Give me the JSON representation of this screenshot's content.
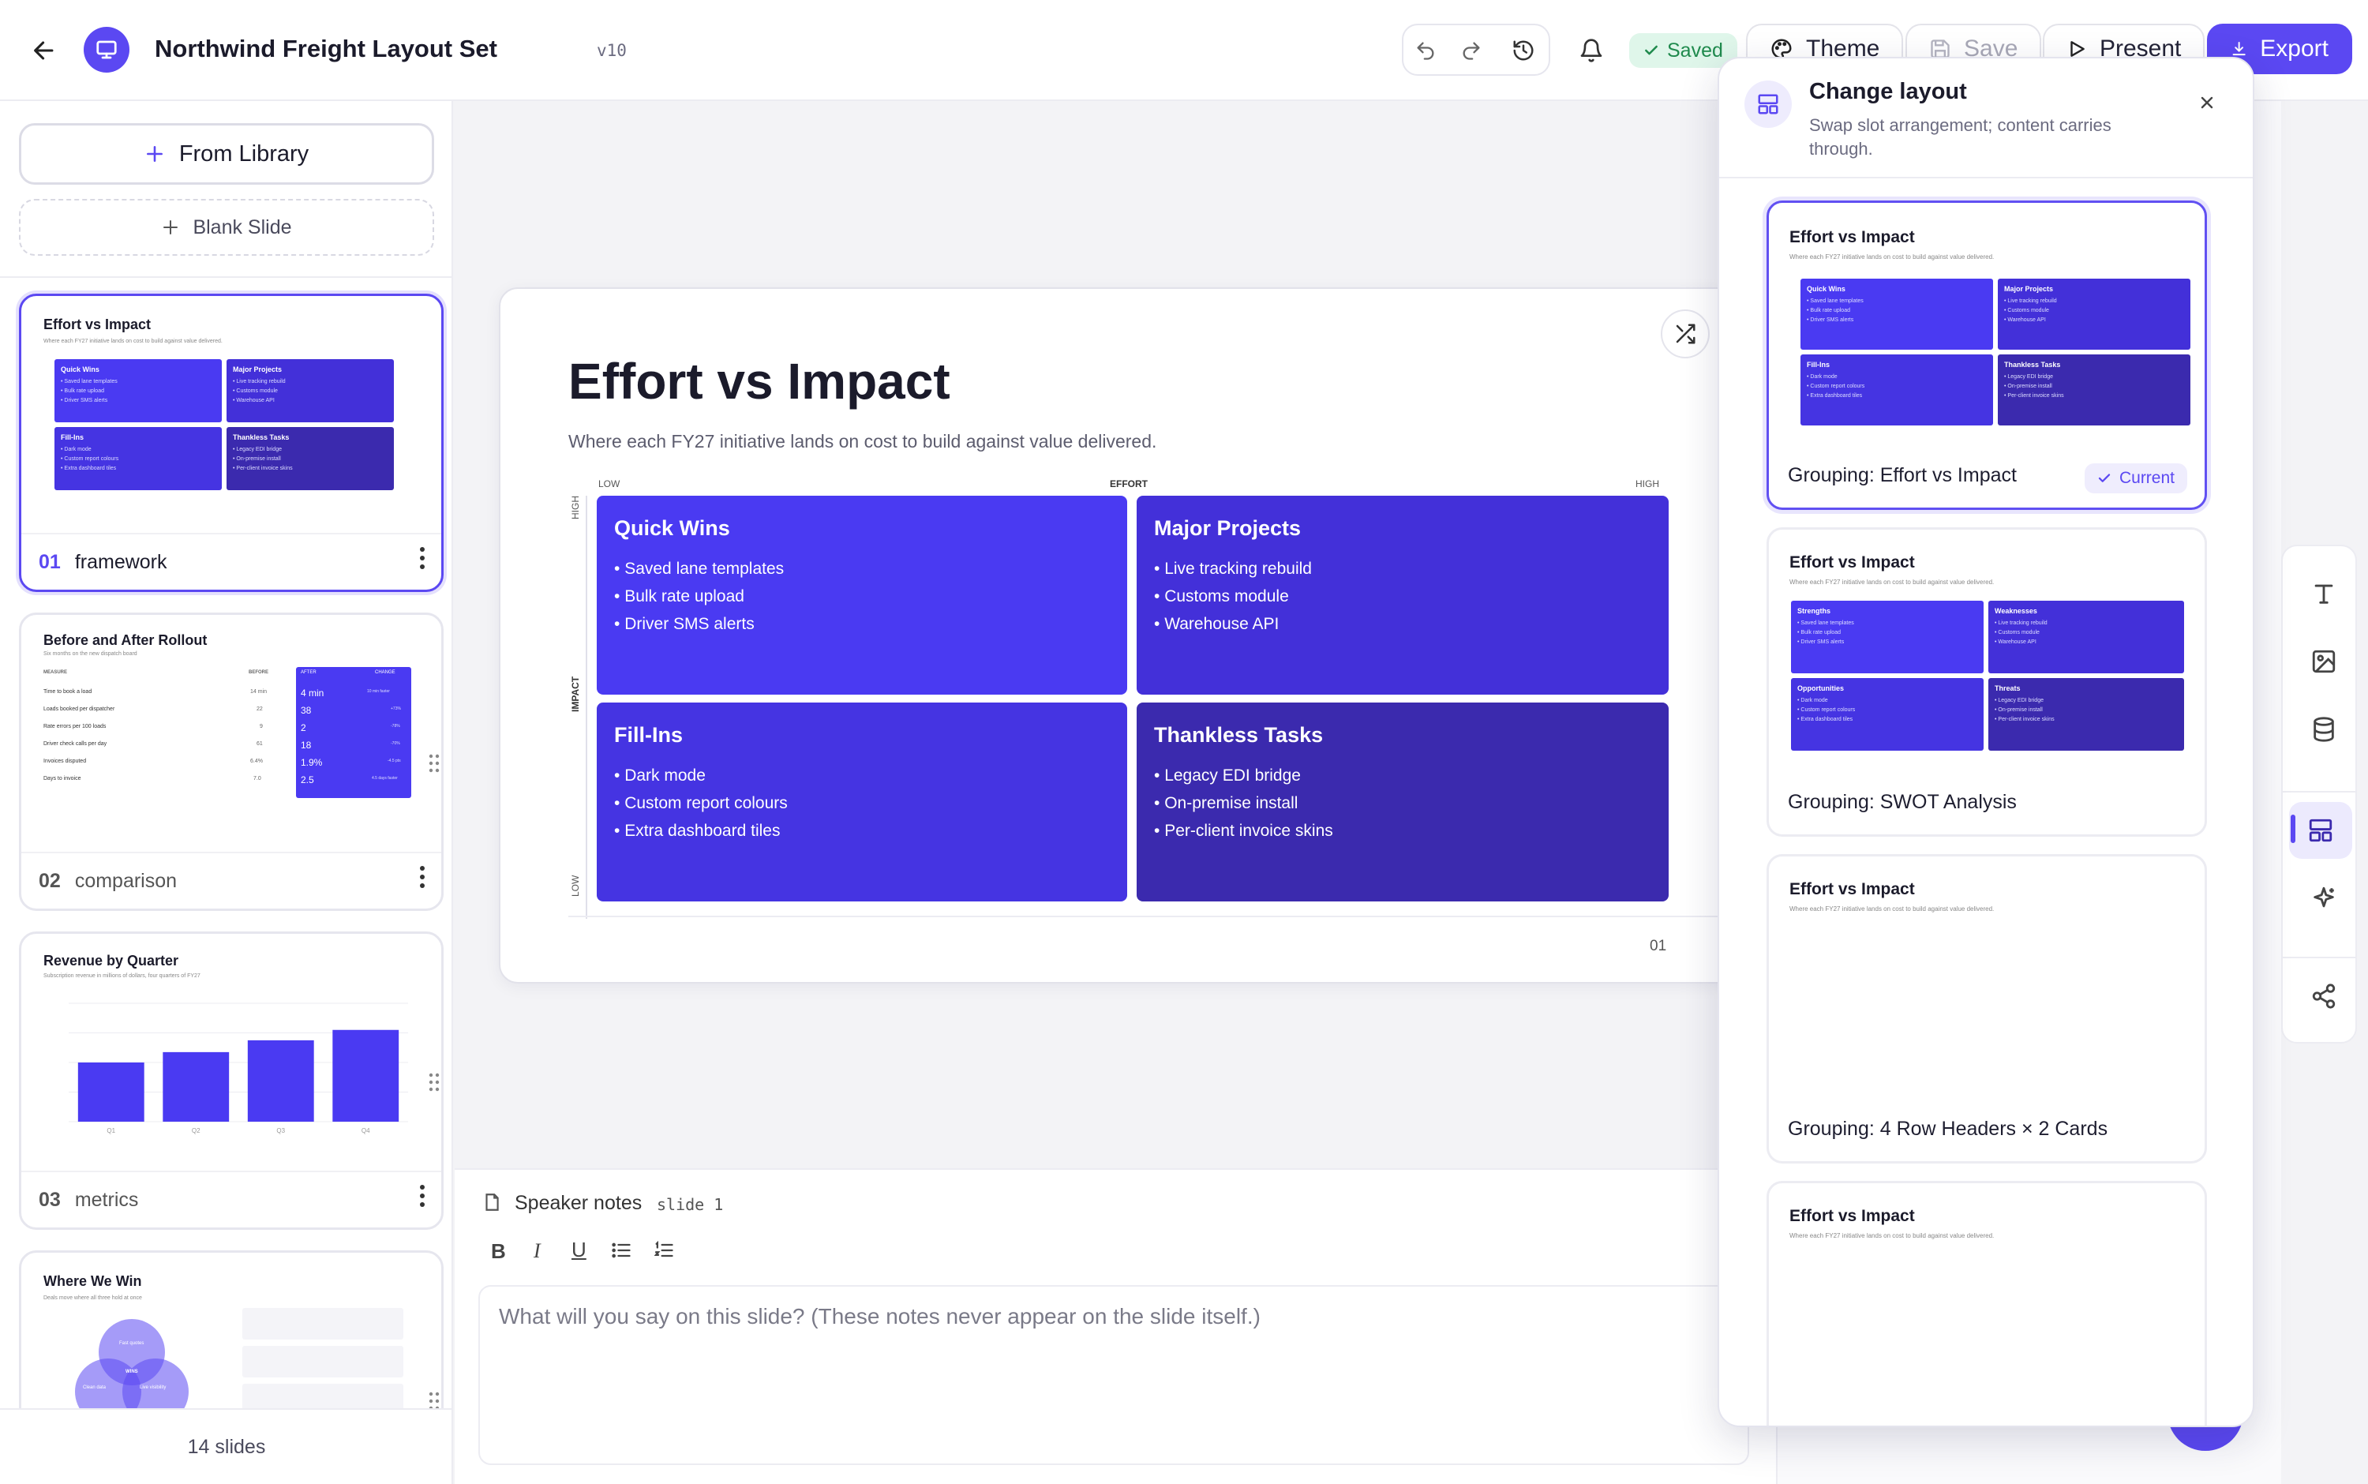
{
  "header": {
    "title": "Northwind Freight Layout Set",
    "version": "v10",
    "saved_label": "Saved",
    "theme_label": "Theme",
    "save_label": "Save",
    "present_label": "Present",
    "export_label": "Export"
  },
  "sidebar": {
    "from_library": "From Library",
    "blank_slide": "Blank Slide",
    "slide_count": "14 slides",
    "slides": [
      {
        "num": "01",
        "layout": "framework",
        "title": "Effort vs Impact"
      },
      {
        "num": "02",
        "layout": "comparison",
        "title": "Before and After Rollout",
        "subtitle": "Six months on the new dispatch board"
      },
      {
        "num": "03",
        "layout": "metrics",
        "title": "Revenue by Quarter",
        "subtitle": "Subscription revenue in millions of dollars, four quarters of FY27"
      },
      {
        "num": "04",
        "layout": "",
        "title": "Where We Win",
        "subtitle": "Deals move where all three hold at once"
      }
    ],
    "comparison": {
      "col_measure": "MEASURE",
      "col_before": "BEFORE",
      "col_after": "AFTER",
      "col_change": "CHANGE",
      "rows": [
        {
          "m": "Time to book a load",
          "b": "14 min",
          "a": "4 min",
          "c": "10 min faster"
        },
        {
          "m": "Loads booked per dispatcher",
          "b": "22",
          "a": "38",
          "c": "+73%"
        },
        {
          "m": "Rate errors per 100 loads",
          "b": "9",
          "a": "2",
          "c": "-78%"
        },
        {
          "m": "Driver check calls per day",
          "b": "61",
          "a": "18",
          "c": "-70%"
        },
        {
          "m": "Invoices disputed",
          "b": "6.4%",
          "a": "1.9%",
          "c": "-4.5 pts"
        },
        {
          "m": "Days to invoice",
          "b": "7.0",
          "a": "2.5",
          "c": "4.5 days faster"
        }
      ]
    },
    "venn": {
      "a": "Fast quotes",
      "b": "Clean data",
      "c": "Live visibility",
      "center": "WINS"
    }
  },
  "slide": {
    "title": "Effort vs Impact",
    "subtitle": "Where each FY27 initiative lands on cost to build against value delivered.",
    "axis_low": "LOW",
    "axis_effort": "EFFORT",
    "axis_high": "HIGH",
    "axis_impact": "IMPACT",
    "axis_high_v": "HIGH",
    "axis_low_v": "LOW",
    "page_num": "01",
    "quadrants": [
      {
        "title": "Quick Wins",
        "items": [
          "Saved lane templates",
          "Bulk rate upload",
          "Driver SMS alerts"
        ],
        "color": "#4a3af2"
      },
      {
        "title": "Major Projects",
        "items": [
          "Live tracking rebuild",
          "Customs module",
          "Warehouse API"
        ],
        "color": "#4330d9"
      },
      {
        "title": "Fill-Ins",
        "items": [
          "Dark mode",
          "Custom report colours",
          "Extra dashboard tiles"
        ],
        "color": "#4534e2"
      },
      {
        "title": "Thankless Tasks",
        "items": [
          "Legacy EDI bridge",
          "On-premise install",
          "Per-client invoice skins"
        ],
        "color": "#3b2aae"
      }
    ]
  },
  "notes": {
    "label": "Speaker notes",
    "tag": "slide 1",
    "placeholder": "What will you say on this slide? (These notes never appear on the slide itself.)"
  },
  "panel": {
    "title": "Change layout",
    "subtitle": "Swap slot arrangement; content carries through.",
    "current_label": "Current",
    "layouts": [
      {
        "name": "Grouping: Effort vs Impact",
        "labels": [
          "Quick Wins",
          "Major Projects",
          "Fill-Ins",
          "Thankless Tasks"
        ]
      },
      {
        "name": "Grouping: SWOT Analysis",
        "labels": [
          "Strengths",
          "Weaknesses",
          "Opportunities",
          "Threats"
        ]
      },
      {
        "name": "Grouping: 4 Row Headers × 2 Cards",
        "labels": []
      },
      {
        "name": "",
        "labels": []
      }
    ]
  },
  "chart_data": {
    "type": "bar",
    "title": "Revenue by Quarter",
    "categories": [
      "Q1",
      "Q2",
      "Q3",
      "Q4"
    ],
    "values": [
      40,
      47,
      55,
      62
    ],
    "ylim": [
      0,
      80
    ]
  }
}
